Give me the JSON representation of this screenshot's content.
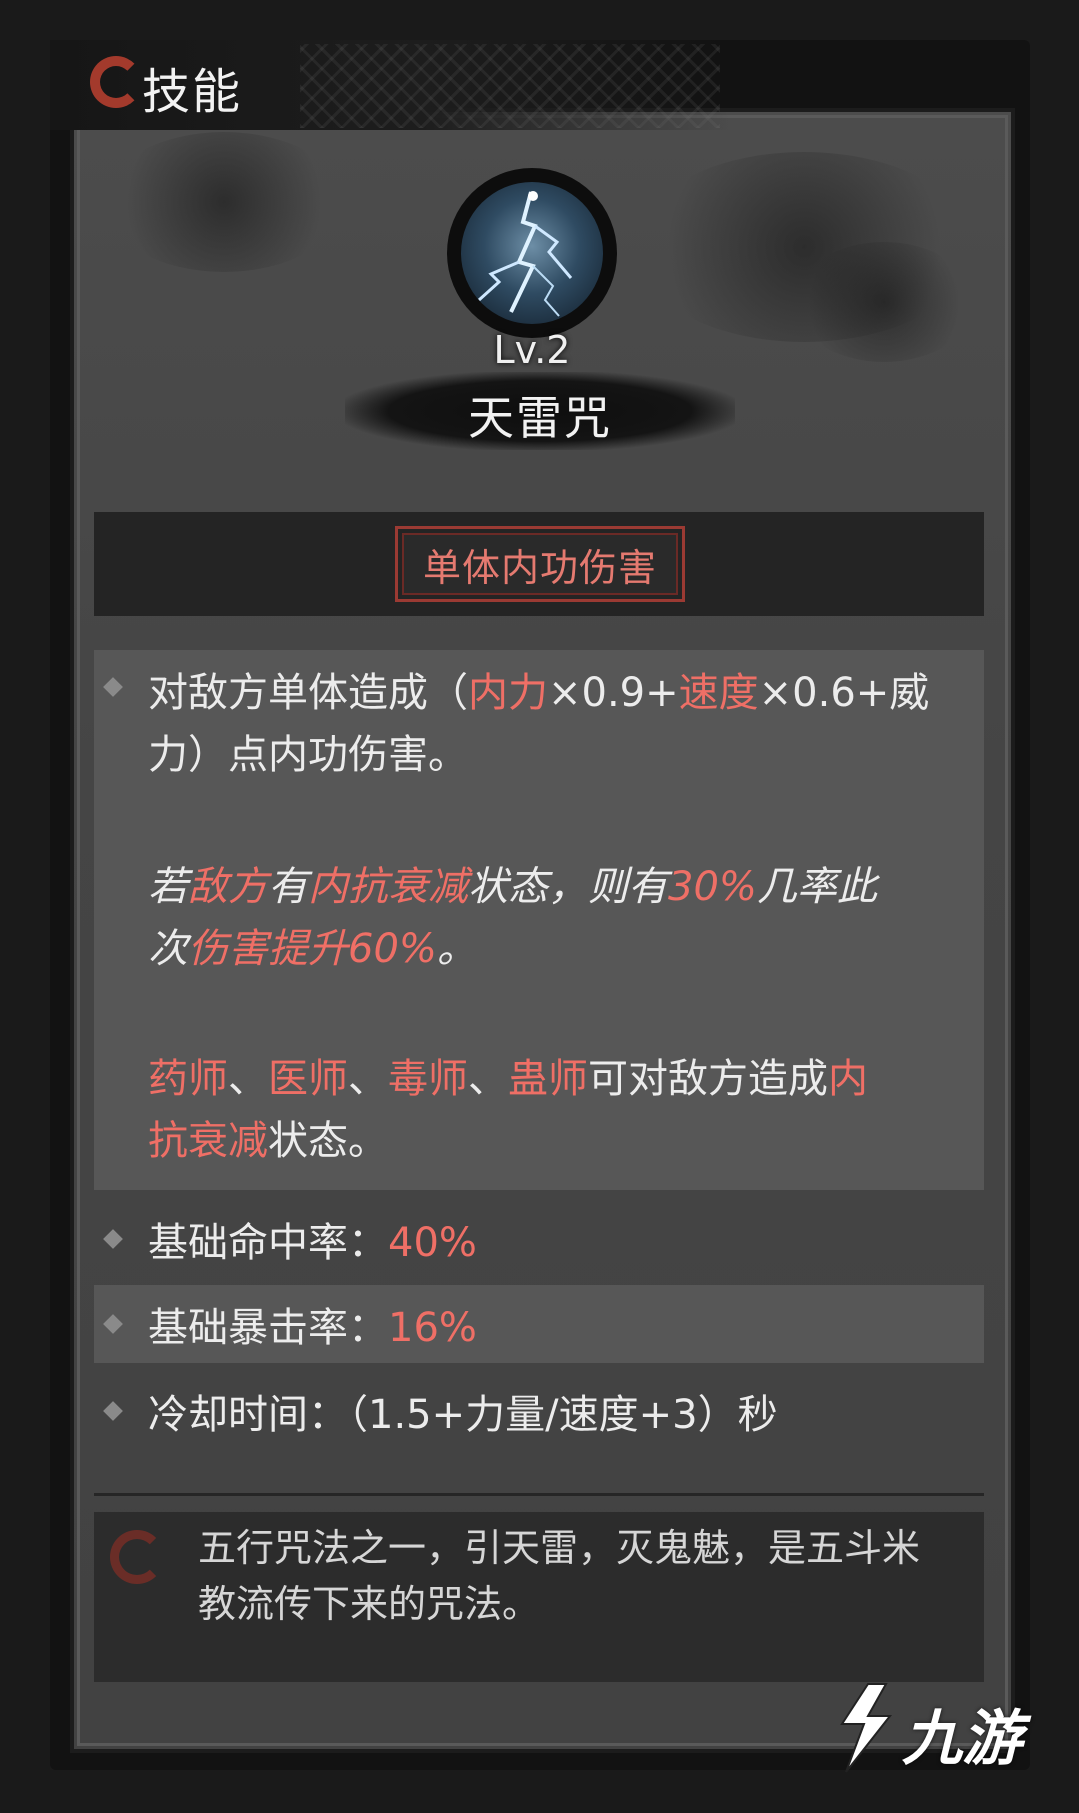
{
  "header": {
    "title": "技能"
  },
  "skill": {
    "level": "Lv.2",
    "name": "天雷咒",
    "type": "单体内功伤害"
  },
  "description": {
    "line1": [
      {
        "t": "对敌方单体造成（",
        "red": false
      },
      {
        "t": "内力",
        "red": true
      },
      {
        "t": "×0.9+",
        "red": false
      },
      {
        "t": "速度",
        "red": true
      },
      {
        "t": "×0.6+威",
        "red": false
      }
    ],
    "line2": "力）点内功伤害。",
    "para2_line1": [
      {
        "t": "若",
        "red": false
      },
      {
        "t": "敌方",
        "red": true
      },
      {
        "t": "有",
        "red": false
      },
      {
        "t": "内抗衰减",
        "red": true
      },
      {
        "t": "状态，则有",
        "red": false
      },
      {
        "t": "30%",
        "red": true
      },
      {
        "t": "几率此",
        "red": false
      }
    ],
    "para2_line2": [
      {
        "t": "次",
        "red": false
      },
      {
        "t": "伤害提升60%",
        "red": true
      },
      {
        "t": "。",
        "red": false
      }
    ],
    "para3_line1": [
      {
        "t": "药师",
        "red": true
      },
      {
        "t": "、",
        "red": false
      },
      {
        "t": "医师",
        "red": true
      },
      {
        "t": "、",
        "red": false
      },
      {
        "t": "毒师",
        "red": true
      },
      {
        "t": "、",
        "red": false
      },
      {
        "t": "蛊师",
        "red": true
      },
      {
        "t": "可对敌方造成",
        "red": false
      },
      {
        "t": "内",
        "red": true
      }
    ],
    "para3_line2": [
      {
        "t": "抗衰减",
        "red": true
      },
      {
        "t": "状态。",
        "red": false
      }
    ]
  },
  "stats": {
    "hit_label": "基础命中率：",
    "hit_value": "40%",
    "crit_label": "基础暴击率：",
    "crit_value": "16%",
    "cooldown_label": "冷却时间：",
    "cooldown_value": "（1.5+力量/速度+3）秒"
  },
  "lore": {
    "line1": "五行咒法之一，引天雷，灭鬼魅，是五斗米",
    "line2": "教流传下来的咒法。"
  },
  "watermark": {
    "text": "九游"
  },
  "colors": {
    "highlight": "#ef6f66",
    "badge_border": "#9b3a33",
    "panel": "#454545"
  }
}
